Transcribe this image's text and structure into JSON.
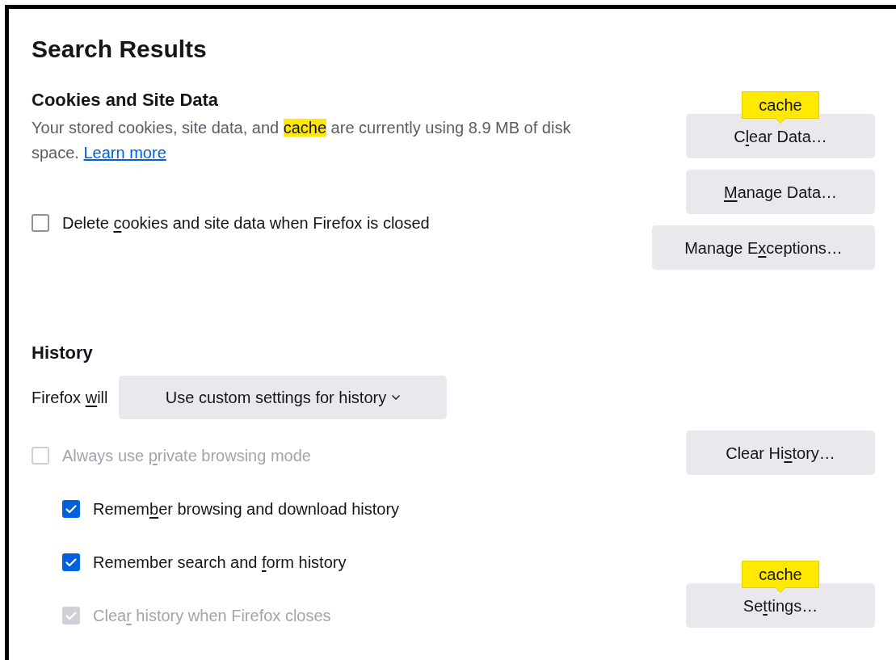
{
  "title": "Search Results",
  "cookies": {
    "heading": "Cookies and Site Data",
    "description": [
      {
        "text": "Your stored cookies, site data, and ",
        "highlighted": false
      },
      {
        "text": "cache",
        "highlighted": true
      },
      {
        "text": " are currently using 8.9 MB of disk space.",
        "highlighted": false
      }
    ],
    "link": "Learn more",
    "options": [
      {
        "label": {
          "before": "Delete ",
          "key": "c",
          "after": "ookies and site data when Firefox is closed"
        },
        "checked": false,
        "disabled": false
      }
    ],
    "buttons": [
      {
        "label": {
          "before": "C",
          "key": "l",
          "after": "ear Data…"
        },
        "tooltip": "cache"
      },
      {
        "label": {
          "key": "M",
          "after": "anage Data…"
        }
      },
      {
        "label": {
          "before": "Manage E",
          "key": "x",
          "after": "ceptions…"
        }
      }
    ]
  },
  "history": {
    "heading": "History",
    "mode_label": {
      "before": "Firefox ",
      "key": "w",
      "after": "ill"
    },
    "mode_value": "Use custom settings for history",
    "options": [
      {
        "label": {
          "before": "Always use ",
          "key": "p",
          "after": "rivate browsing mode"
        },
        "checked": false,
        "disabled": true,
        "children": [
          {
            "label": {
              "before": "Remem",
              "key": "b",
              "after": "er browsing and download history"
            },
            "checked": true,
            "disabled": false
          },
          {
            "label": {
              "before": "Remember search and ",
              "key": "f",
              "after": "orm history"
            },
            "checked": true,
            "disabled": false
          },
          {
            "label": {
              "before": "Clea",
              "key": "r",
              "after": " history when Firefox closes"
            },
            "checked": true,
            "disabled": true
          }
        ]
      }
    ],
    "buttons": [
      {
        "label": {
          "before": "Clear Hi",
          "key": "s",
          "after": "tory…"
        }
      },
      {
        "label": {
          "before": "Se",
          "key": "t",
          "after": "tings…"
        },
        "tooltip": "cache"
      }
    ]
  }
}
